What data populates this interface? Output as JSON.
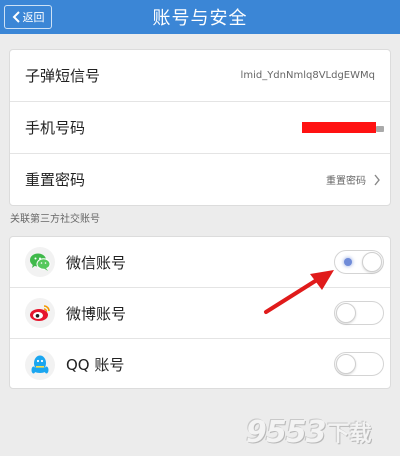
{
  "header": {
    "back_label": "返回",
    "title": "账号与安全"
  },
  "account": {
    "rows": [
      {
        "label": "子弹短信号",
        "value": "lmid_YdnNmlq8VLdgEWMq"
      },
      {
        "label": "手机号码",
        "value": ""
      },
      {
        "label": "重置密码",
        "value": "重置密码"
      }
    ]
  },
  "social": {
    "section_label": "关联第三方社交账号",
    "rows": [
      {
        "label": "微信账号",
        "icon": "wechat-icon",
        "icon_color": "#3fb94a",
        "toggle": "on"
      },
      {
        "label": "微博账号",
        "icon": "weibo-icon",
        "icon_color": "#e6162d",
        "toggle": "off"
      },
      {
        "label": "QQ 账号",
        "icon": "qq-icon",
        "icon_color": "#1aa6f0",
        "toggle": "off"
      }
    ]
  },
  "annotation": {
    "arrow_color": "#e01b1b",
    "redaction_color": "#ff1212"
  },
  "watermark": {
    "digits": "9553",
    "chars": "下载"
  }
}
